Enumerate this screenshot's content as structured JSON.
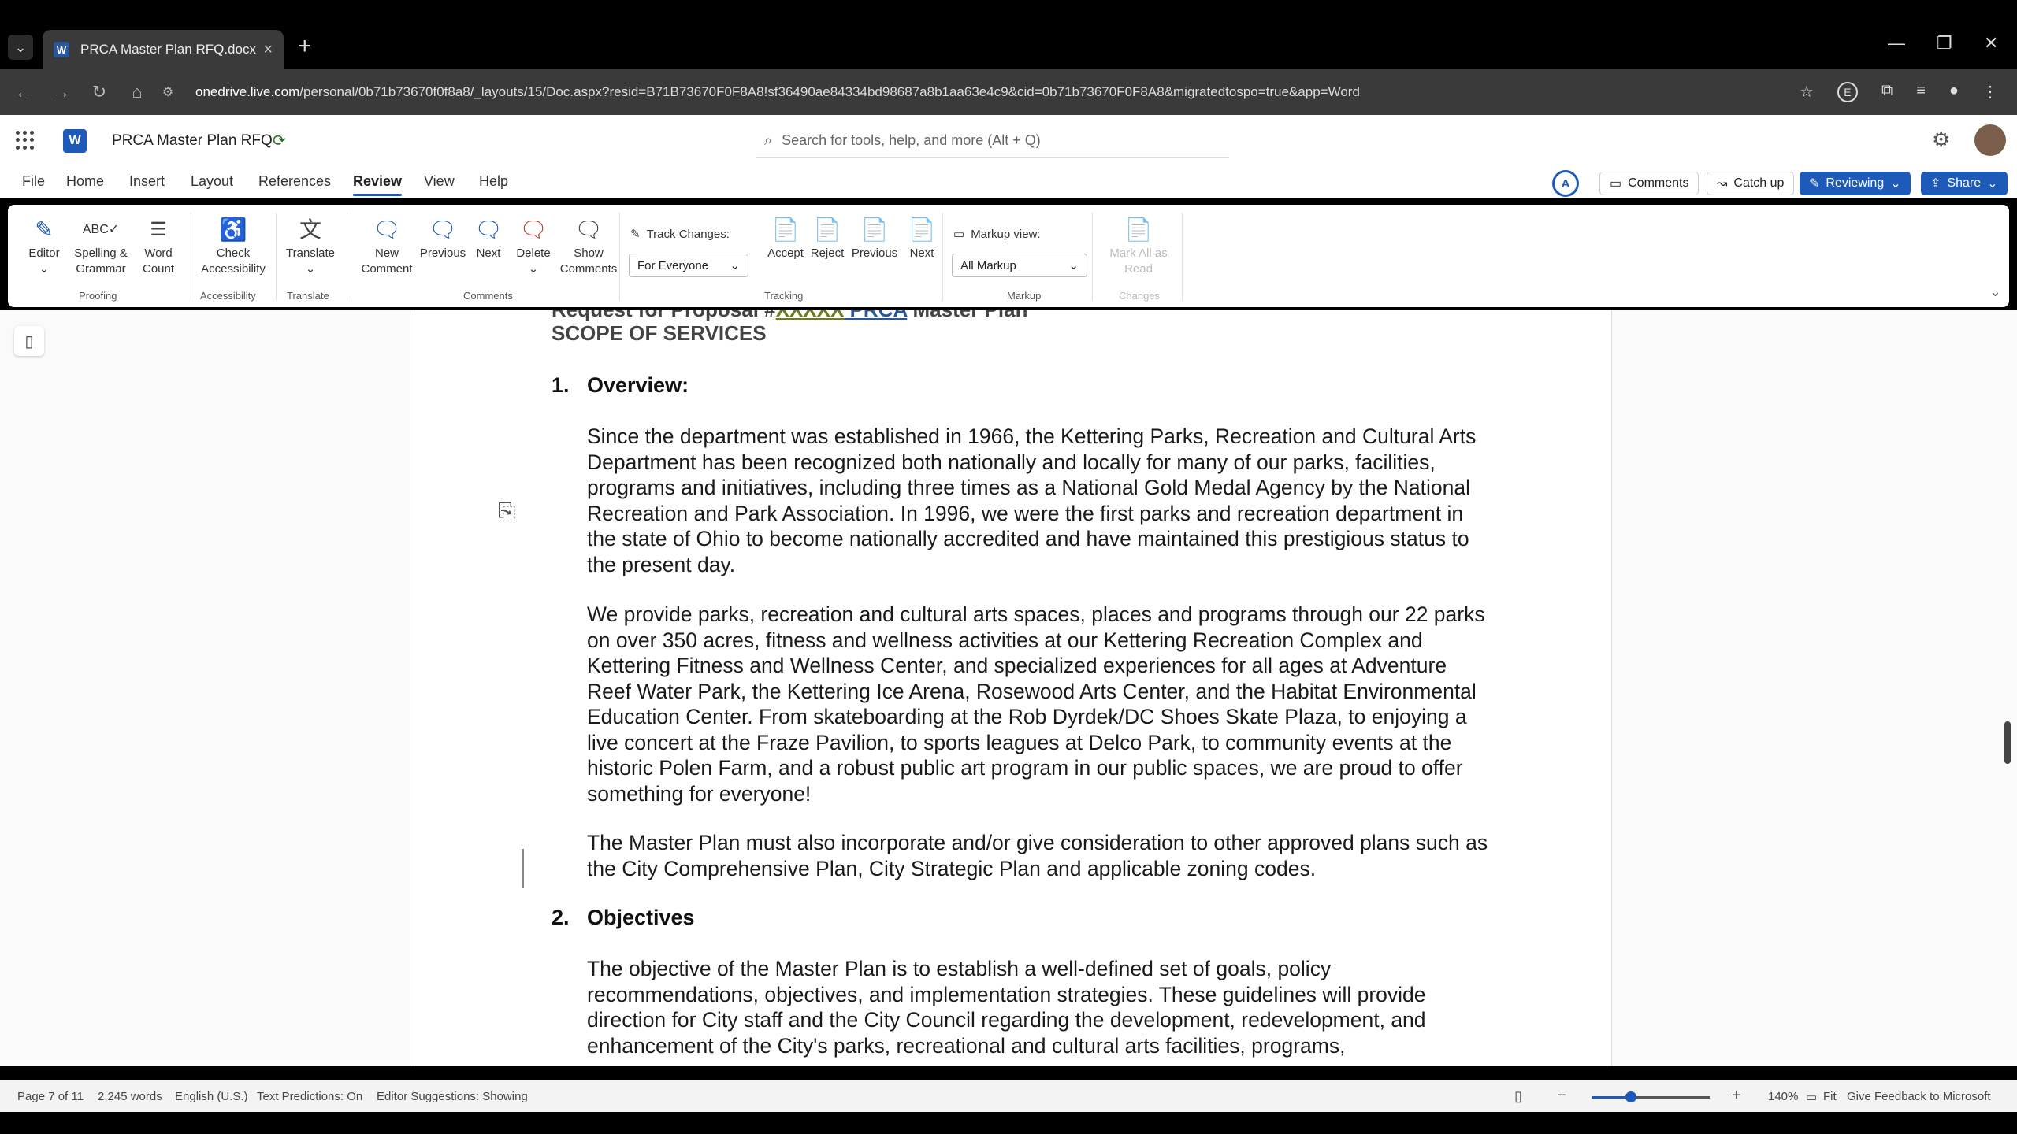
{
  "browser": {
    "tab_title": "PRCA Master Plan RFQ.docx",
    "favicon_letter": "W",
    "url_domain": "onedrive.live.com",
    "url_rest": "/personal/0b71b73670f0f8a8/_layouts/15/Doc.aspx?resid=B71B73670F0F8A8!sf36490ae84334bd98687a8b1aa63e4c9&cid=0b71b73670F0F8A8&migratedtospo=true&app=Word",
    "extension_badge": "E"
  },
  "app": {
    "doc_title": "PRCA Master Plan RFQ",
    "search_placeholder": "Search for tools, help, and more (Alt + Q)",
    "copilot_initial": "A",
    "comments_btn": "Comments",
    "catchup_btn": "Catch up",
    "reviewing_btn": "Reviewing",
    "share_btn": "Share"
  },
  "menu_tabs": [
    "File",
    "Home",
    "Insert",
    "Layout",
    "References",
    "Review",
    "View",
    "Help"
  ],
  "active_tab": "Review",
  "ribbon": {
    "editor": "Editor",
    "spelling": "Spelling &",
    "spelling2": "Grammar",
    "word_count": "Word",
    "word_count2": "Count",
    "check": "Check",
    "accessibility": "Accessibility",
    "translate": "Translate",
    "new_comment": "New",
    "new_comment2": "Comment",
    "previous": "Previous",
    "next": "Next",
    "delete": "Delete",
    "show": "Show",
    "comments": "Comments",
    "track_changes_label": "Track Changes:",
    "track_changes_value": "For Everyone",
    "accept": "Accept",
    "reject": "Reject",
    "prev2": "Previous",
    "next2": "Next",
    "markup_view_label": "Markup view:",
    "markup_value": "All Markup",
    "mark_all": "Mark All as",
    "mark_all2": "Read",
    "groups": {
      "proofing": "Proofing",
      "accessibility": "Accessibility",
      "translate": "Translate",
      "comments": "Comments",
      "tracking": "Tracking",
      "markup": "Markup",
      "changes": "Changes"
    }
  },
  "document": {
    "heading_partial_a": "Request for Proposal #",
    "heading_partial_b": "XXXXX",
    "heading_partial_c": " PRCA",
    "heading_partial_d": " Master Plan",
    "scope": "SCOPE OF SERVICES",
    "sec1_num": "1.",
    "sec1_title": "Overview:",
    "p1": "Since the department was established in 1966, the Kettering Parks, Recreation and Cultural Arts Department has been recognized both nationally and locally for many of our parks, facilities, programs and initiatives, including three times as a National Gold Medal Agency by the National Recreation and Park Association. In 1996, we were the first parks and recreation department in the state of Ohio to become nationally accredited and have maintained this prestigious status to the present day.",
    "p2": "We provide parks, recreation and cultural arts spaces, places and programs through our 22 parks on over 350 acres, fitness and wellness activities at our Kettering Recreation Complex and Kettering Fitness and Wellness Center, and specialized experiences for all ages at Adventure Reef Water Park, the Kettering Ice Arena, Rosewood Arts Center, and the Habitat Environmental Education Center. From skateboarding at the Rob Dyrdek/DC Shoes Skate Plaza, to enjoying a live concert at the Fraze Pavilion, to sports leagues at Delco Park, to community events at the historic Polen Farm, and a robust public art program in our public spaces, we are proud to offer something for everyone!",
    "p3": "The Master Plan must also incorporate and/or give consideration to other approved plans such as the City Comprehensive Plan, City Strategic Plan and applicable zoning codes.",
    "sec2_num": "2.",
    "sec2_title": "Objectives",
    "p4": "The objective of the Master Plan is to establish a well-defined set of goals, policy recommendations, objectives, and implementation strategies. These guidelines will provide direction for City staff and the City Council regarding the development, redevelopment, and enhancement of the City's parks, recreational and cultural arts facilities, programs,"
  },
  "status": {
    "page": "Page 7 of 11",
    "words": "2,245 words",
    "language": "English (U.S.)",
    "predictions": "Text Predictions: On",
    "editor": "Editor Suggestions: Showing",
    "zoom": "140%",
    "fit": "Fit",
    "feedback": "Give Feedback to Microsoft",
    "zoom_level": 0.33
  },
  "colors": {
    "accent": "#1e5bb8",
    "tab_bg": "#3a3a3a"
  }
}
